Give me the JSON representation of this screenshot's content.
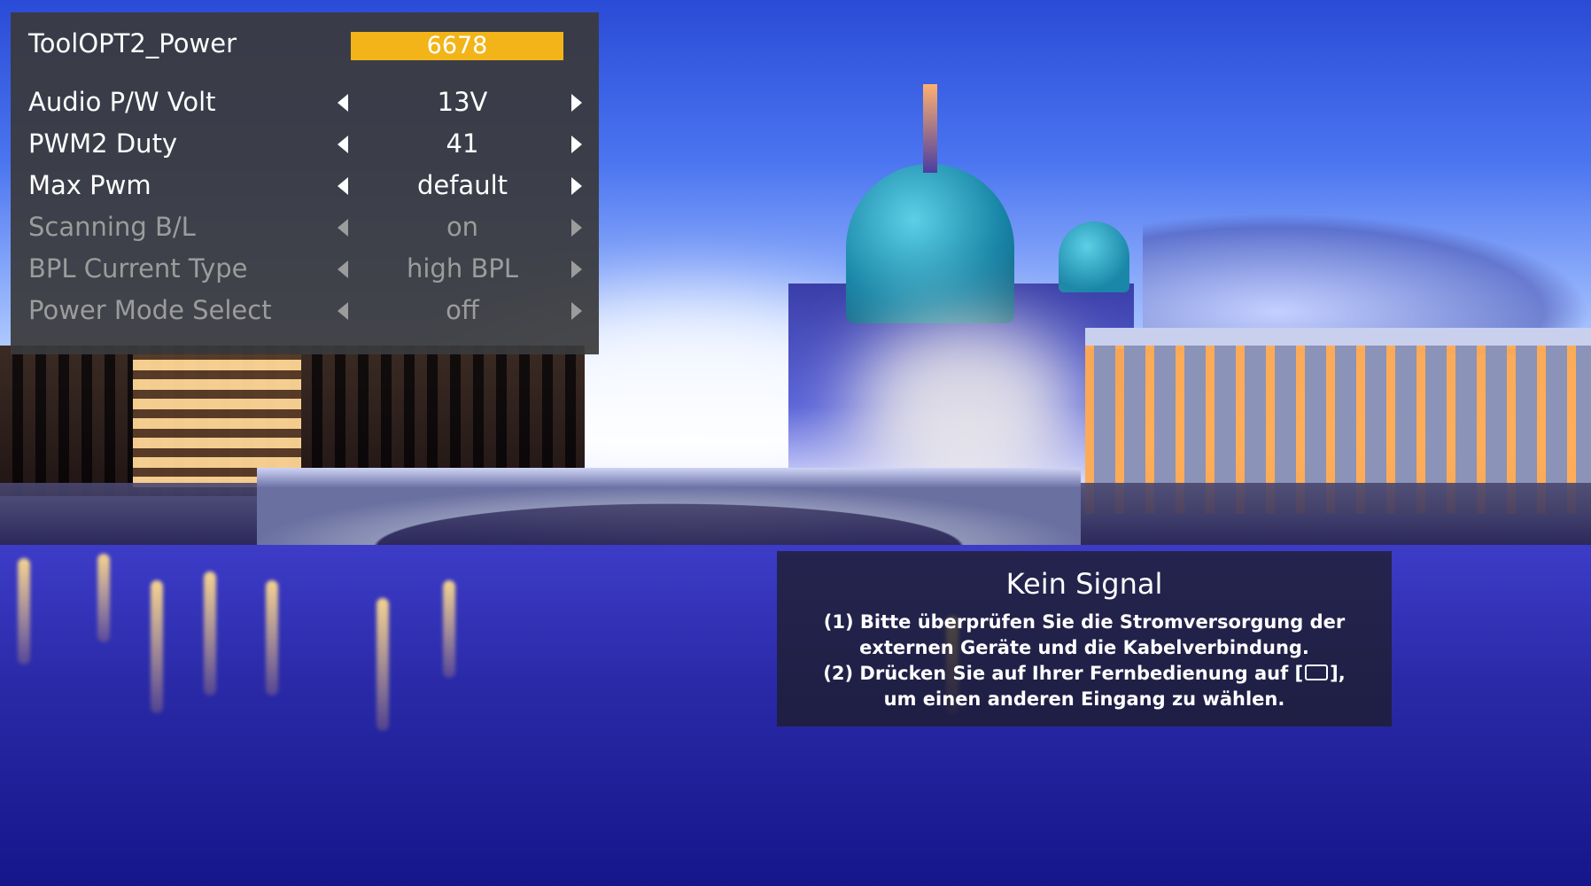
{
  "service_menu": {
    "header": {
      "label": "ToolOPT2_Power",
      "value": "6678"
    },
    "rows": [
      {
        "label": "Audio P/W Volt",
        "value": "13V",
        "enabled": true
      },
      {
        "label": "PWM2 Duty",
        "value": "41",
        "enabled": true
      },
      {
        "label": "Max Pwm",
        "value": "default",
        "enabled": true
      },
      {
        "label": "Scanning B/L",
        "value": "on",
        "enabled": false
      },
      {
        "label": "BPL Current Type",
        "value": "high BPL",
        "enabled": false
      },
      {
        "label": "Power Mode Select",
        "value": "off",
        "enabled": false
      }
    ]
  },
  "no_signal": {
    "title": "Kein Signal",
    "line1": "(1) Bitte überprüfen Sie die Stromversorgung der",
    "line2": "externen Geräte und die Kabelverbindung.",
    "line3_prefix": "(2) Drücken Sie auf Ihrer Fernbedienung auf [",
    "line3_suffix": "],",
    "line4": "um einen anderen Eingang zu wählen.",
    "input_icon": "input-source-icon"
  },
  "colors": {
    "menu_bg": "#3a3a3c",
    "highlight": "#f2b418",
    "dim_text": "#9c9c9c"
  }
}
